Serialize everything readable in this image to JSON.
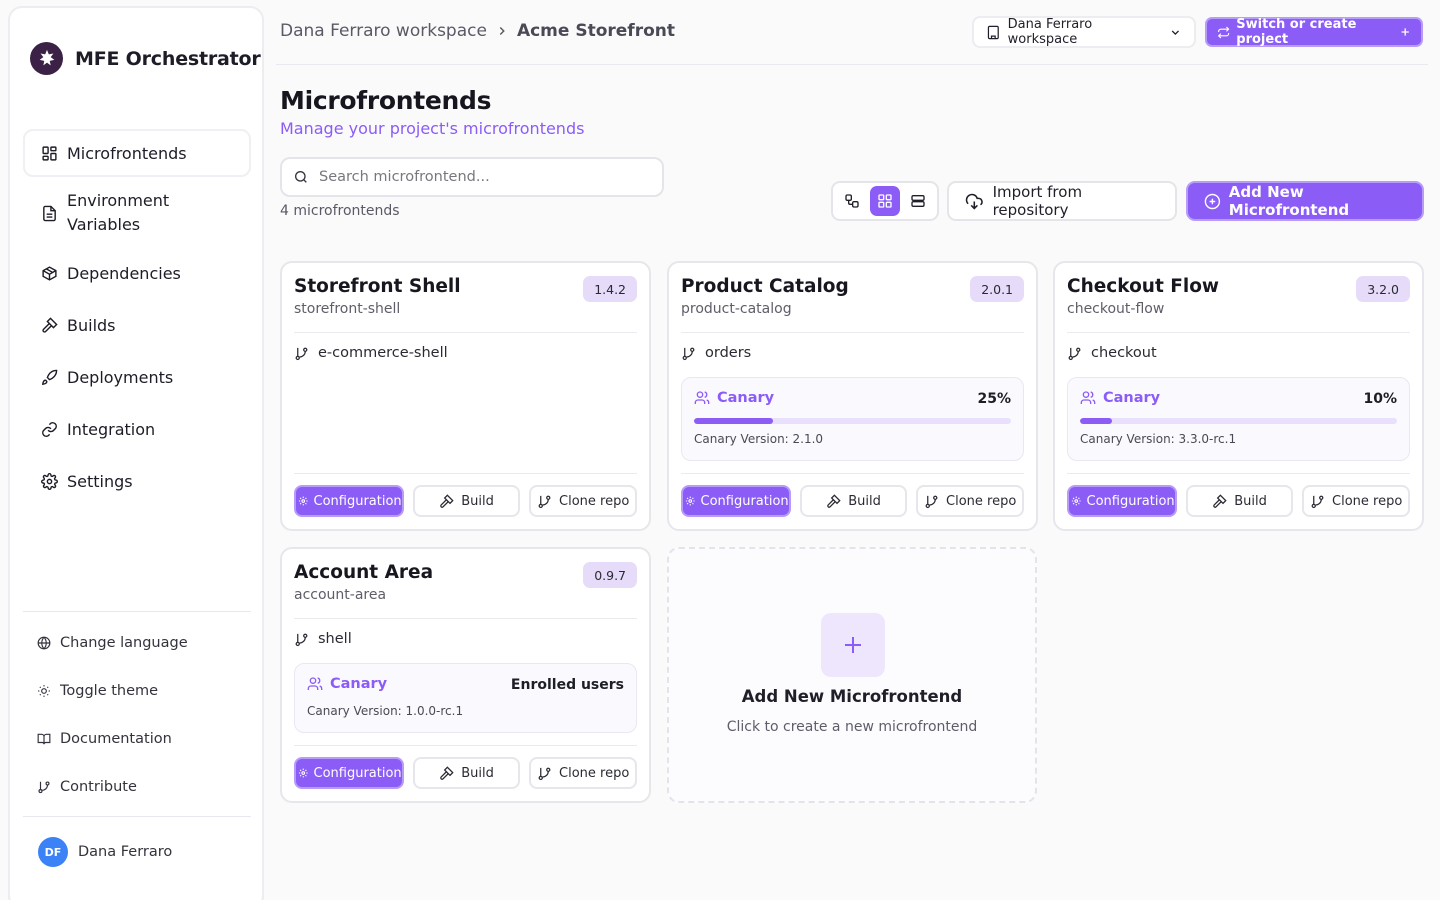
{
  "brand": {
    "name": "MFE Orchestrator"
  },
  "nav": [
    {
      "label": "Microfrontends",
      "icon": "grid-icon",
      "active": true
    },
    {
      "label": "Environment Variables",
      "icon": "file-text-icon"
    },
    {
      "label": "Dependencies",
      "icon": "package-icon"
    },
    {
      "label": "Builds",
      "icon": "hammer-icon"
    },
    {
      "label": "Deployments",
      "icon": "rocket-icon"
    },
    {
      "label": "Integration",
      "icon": "link-icon"
    },
    {
      "label": "Settings",
      "icon": "gear-icon"
    }
  ],
  "footer": [
    {
      "label": "Change language",
      "icon": "globe-icon"
    },
    {
      "label": "Toggle theme",
      "icon": "sun-icon"
    },
    {
      "label": "Documentation",
      "icon": "book-icon"
    },
    {
      "label": "Contribute",
      "icon": "git-branch-icon"
    }
  ],
  "user": {
    "initials": "DF",
    "name": "Dana Ferraro"
  },
  "breadcrumb": {
    "workspace": "Dana Ferraro workspace",
    "project": "Acme Storefront"
  },
  "header": {
    "workspace_select": "Dana Ferraro workspace",
    "switch_label": "Switch or create project"
  },
  "page": {
    "title": "Microfrontends",
    "subtitle": "Manage your project's microfrontends",
    "search_placeholder": "Search microfrontend...",
    "count": "4 microfrontends",
    "import_label": "Import from repository",
    "add_label": "Add New Microfrontend"
  },
  "cards": [
    {
      "name": "Storefront Shell",
      "slug": "storefront-shell",
      "version": "1.4.2",
      "branch": "e-commerce-shell"
    },
    {
      "name": "Product Catalog",
      "slug": "product-catalog",
      "version": "2.0.1",
      "branch": "orders",
      "canary": {
        "label": "Canary",
        "value": "25%",
        "percent": 25,
        "version": "Canary Version: 2.1.0"
      }
    },
    {
      "name": "Checkout Flow",
      "slug": "checkout-flow",
      "version": "3.2.0",
      "branch": "checkout",
      "canary": {
        "label": "Canary",
        "value": "10%",
        "percent": 10,
        "version": "Canary Version: 3.3.0-rc.1"
      }
    },
    {
      "name": "Account Area",
      "slug": "account-area",
      "version": "0.9.7",
      "branch": "shell",
      "canary": {
        "label": "Canary",
        "value": "Enrolled users",
        "version": "Canary Version: 1.0.0-rc.1"
      }
    }
  ],
  "card_actions": {
    "configuration": "Configuration",
    "build": "Build",
    "clone": "Clone repo"
  },
  "add_card": {
    "title": "Add New Microfrontend",
    "subtitle": "Click to create a new microfrontend"
  },
  "colors": {
    "accent": "#8b5cf6",
    "accent_soft": "#e6dcfa"
  }
}
